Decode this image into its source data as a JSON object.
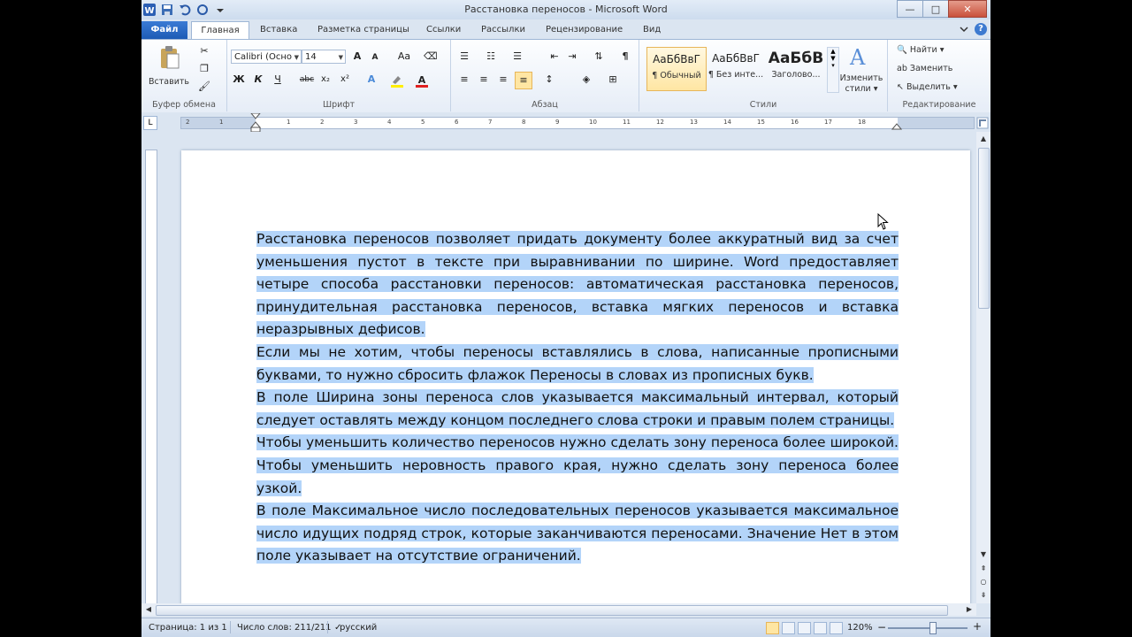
{
  "window": {
    "title": "Расстановка переносов - Microsoft Word",
    "controls": {
      "minimize": "—",
      "maximize": "□",
      "close": "✕"
    }
  },
  "tabs": [
    "Файл",
    "Главная",
    "Вставка",
    "Разметка страницы",
    "Ссылки",
    "Рассылки",
    "Рецензирование",
    "Вид"
  ],
  "ribbon": {
    "clipboard": {
      "paste_label": "Вставить",
      "group_label": "Буфер обмена"
    },
    "font": {
      "font_name": "Calibri (Осно",
      "font_size": "14",
      "group_label": "Шрифт",
      "bold": "Ж",
      "italic": "К",
      "underline": "Ч",
      "strike": "abc",
      "sub": "x₂",
      "sup": "x²"
    },
    "paragraph": {
      "group_label": "Абзац"
    },
    "styles": {
      "group_label": "Стили",
      "items": [
        {
          "sample": "АаБбВвГ",
          "name": "¶ Обычный"
        },
        {
          "sample": "АаБбВвГ",
          "name": "¶ Без инте..."
        },
        {
          "sample": "АаБбВ",
          "name": "Заголово..."
        }
      ],
      "change_label_1": "Изменить",
      "change_label_2": "стили ▾"
    },
    "editing": {
      "group_label": "Редактирование",
      "find": "Найти ▾",
      "replace": "Заменить",
      "select": "Выделить ▾"
    }
  },
  "ruler": {
    "ticks": [
      "2",
      "1",
      "1",
      "2",
      "3",
      "4",
      "5",
      "6",
      "7",
      "8",
      "9",
      "10",
      "11",
      "12",
      "13",
      "14",
      "15",
      "16",
      "17",
      "18"
    ]
  },
  "document": {
    "paragraphs": [
      "Расстановка переносов позволяет придать документу более аккуратный вид за счет уменьшения пустот в  тексте при выравнивании по ширине. Word предоставляет четыре способа  расстановки переносов: автоматическая расстановка переносов, принудительная расстановка  переносов, вставка мягких переносов и вставка неразрывных дефисов.",
      "Если мы не хотим,  чтобы переносы вставлялись в слова, написанные прописными буквами, то нужно сбросить флажок Переносы в словах из прописных букв.",
      "В поле Ширина зоны переноса слов  указывается  максимальный интервал, который следует оставлять между концом последнего слова строки и правым полем страницы.",
      "Чтобы уменьшить количество переносов нужно сделать зону переноса более широкой. Чтобы уменьшить неровность  правого края, нужно сделать зону переноса более узкой.",
      "В поле Максимальное число последовательных переносов указывается максимальное число идущих   подряд строк, которые заканчиваются переносами. Значение Нет в этом поле указывает на отсутствие ограничений."
    ]
  },
  "status": {
    "page": "Страница: 1 из 1",
    "words": "Число слов: 211/211",
    "language": "русский",
    "zoom": "120%"
  },
  "colors": {
    "selection": "#b3d4f9",
    "file_tab": "#1d5bb5",
    "ribbon_bg": "#e6edf7"
  }
}
